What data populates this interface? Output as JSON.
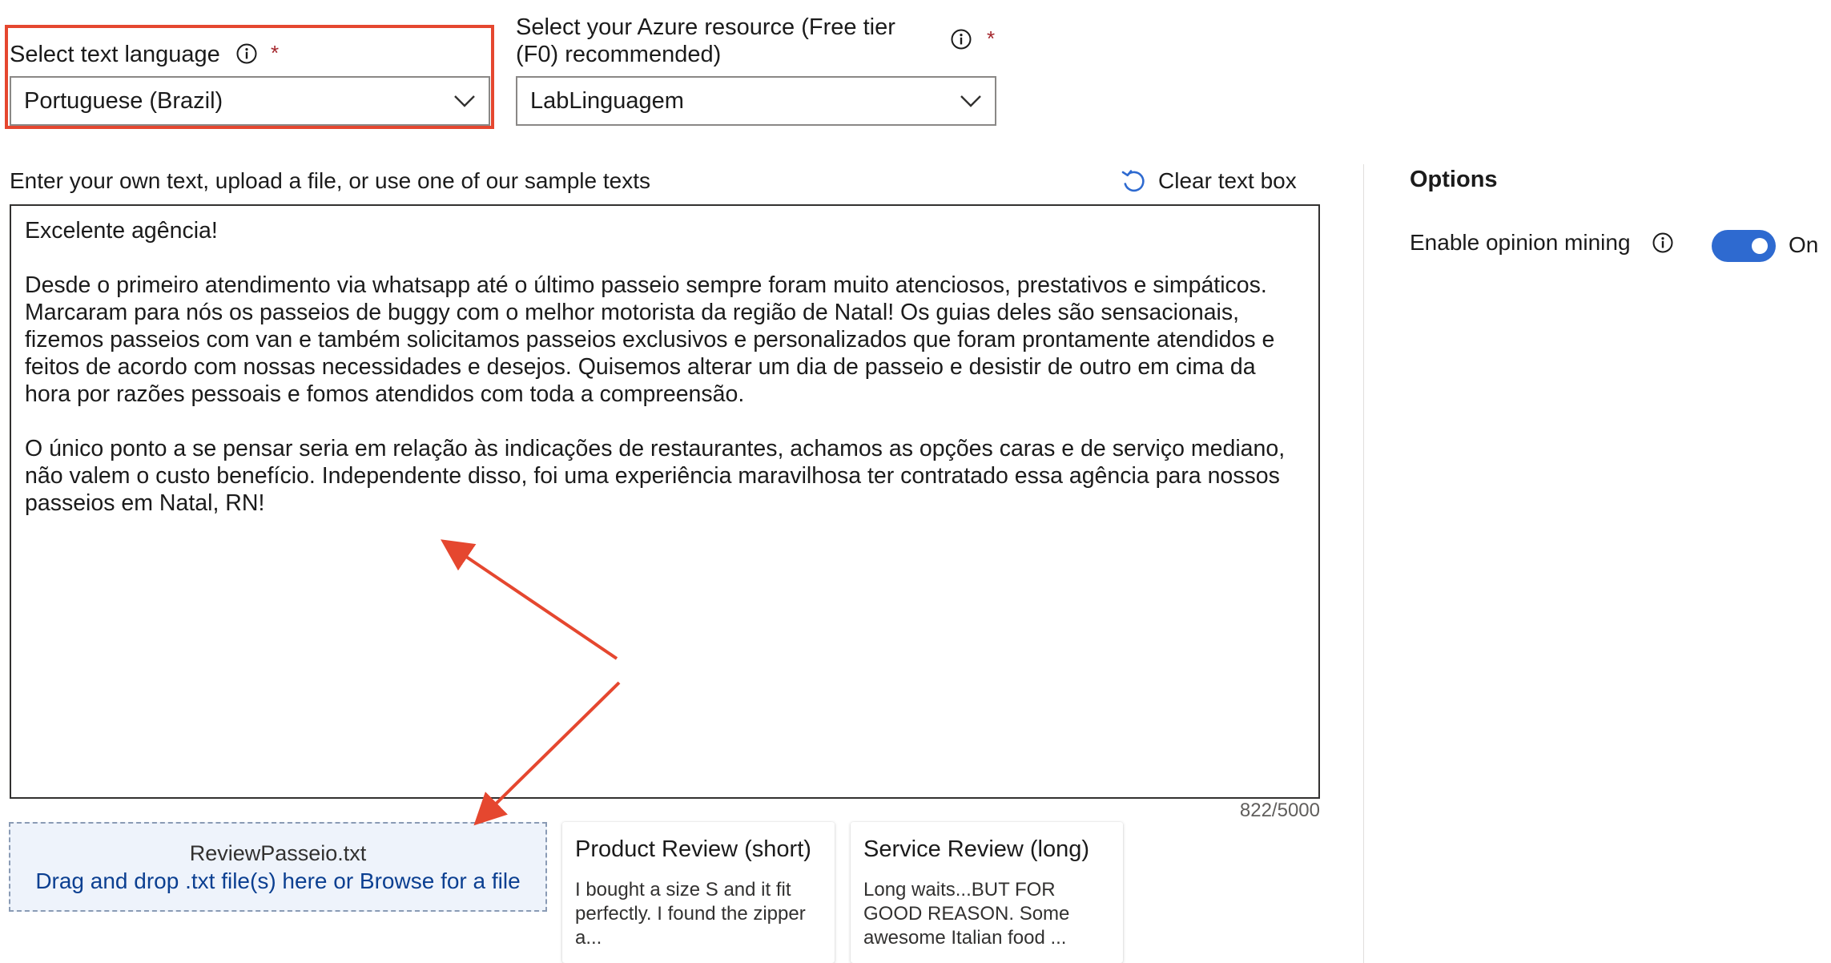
{
  "language_field": {
    "label": "Select text language",
    "required_mark": "*",
    "selected": "Portuguese (Brazil)"
  },
  "resource_field": {
    "label_line1": "Select your Azure resource (Free tier",
    "label_line2": "(F0) recommended)",
    "required_mark": "*",
    "selected": "LabLinguagem"
  },
  "input_section": {
    "label": "Enter your own text, upload a file, or use one of our sample texts",
    "clear_label": "Clear text box",
    "text": "Excelente agência!\n\nDesde o primeiro atendimento via whatsapp até o último passeio sempre foram muito atenciosos, prestativos e simpáticos. Marcaram para nós os passeios de buggy com o melhor motorista da região de Natal! Os guias deles são sensacionais, fizemos passeios com van e também solicitamos passeios exclusivos e personalizados que foram prontamente atendidos e feitos de acordo com nossas necessidades e desejos. Quisemos alterar um dia de passeio e desistir de outro em cima da hora por razões pessoais e fomos atendidos com toda a compreensão.\n\nO único ponto a se pensar seria em relação às indicações de restaurantes, achamos as opções caras e de serviço mediano, não valem o custo benefício. Independente disso, foi uma experiência maravilhosa ter contratado essa agência para nossos passeios em Natal, RN!",
    "char_count": "822/5000"
  },
  "upload": {
    "file_name": "ReviewPasseio.txt",
    "hint": "Drag and drop .txt file(s) here or Browse for a file"
  },
  "samples": [
    {
      "title": "Product Review (short)",
      "preview": "I bought a size S and it fit perfectly. I found the zipper a..."
    },
    {
      "title": "Service Review (long)",
      "preview": "Long waits...BUT FOR GOOD REASON. Some awesome Italian food ..."
    }
  ],
  "options": {
    "title": "Options",
    "opinion_mining_label": "Enable opinion mining",
    "opinion_mining_state": "On",
    "opinion_mining_enabled": true
  },
  "colors": {
    "highlight": "#e5472f",
    "toggle_on": "#2e6ad0",
    "link": "#0b3f91",
    "required": "#a4262c",
    "dropzone_bg": "#eef3fb"
  },
  "icons": {
    "info": "info-icon",
    "chevron": "chevron-down-icon",
    "clear": "undo-icon"
  }
}
